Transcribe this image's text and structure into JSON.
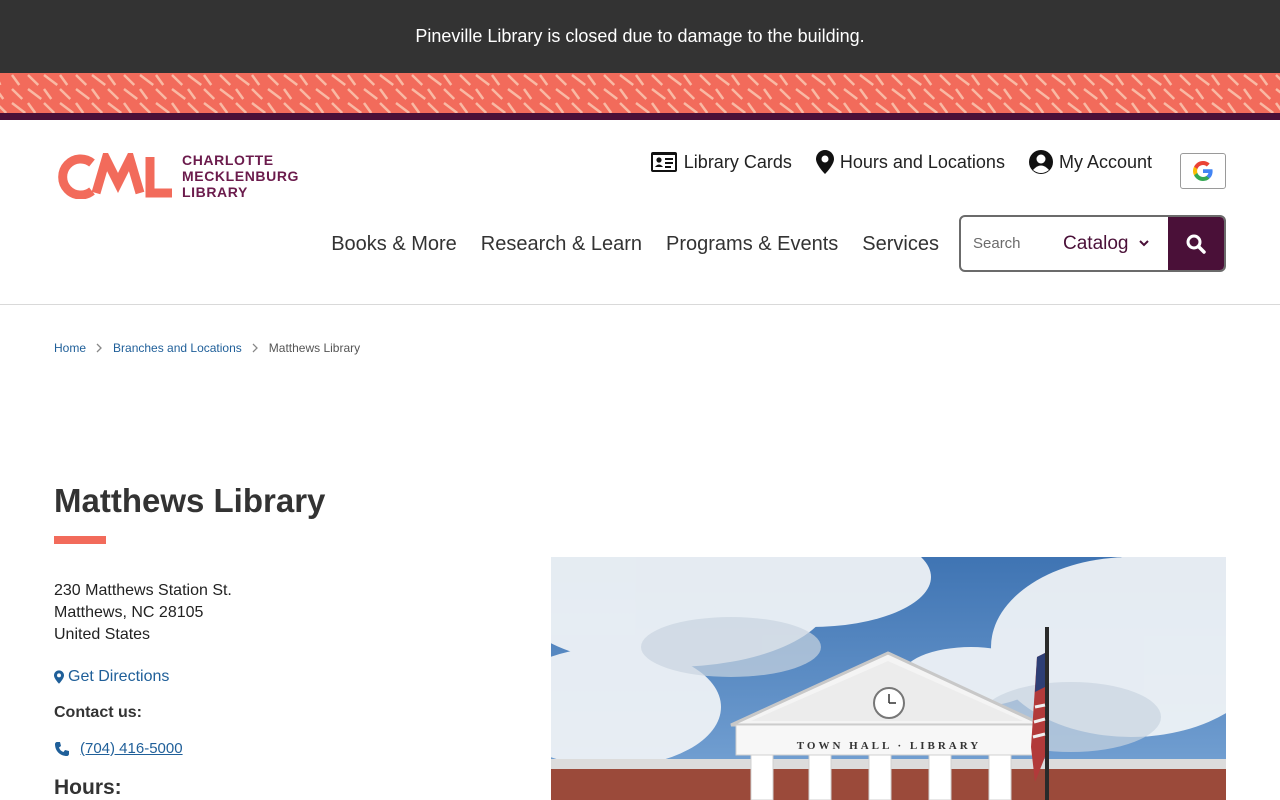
{
  "alert": {
    "message": "Pineville Library is closed due to damage to the building."
  },
  "brand": {
    "logo_mark": "CML",
    "logo_lines": [
      "CHARLOTTE",
      "MECKLENBURG",
      "LIBRARY"
    ],
    "colors": {
      "plum": "#4a1038",
      "coral": "#f26b5b",
      "dark_bar": "#333333",
      "link": "#1f5f99"
    }
  },
  "utility_nav": [
    {
      "label": "Library Cards",
      "icon": "id-card-icon"
    },
    {
      "label": "Hours and Locations",
      "icon": "map-pin-icon"
    },
    {
      "label": "My Account",
      "icon": "user-circle-icon"
    }
  ],
  "google_translate": {
    "icon": "google-g-icon"
  },
  "main_nav": [
    {
      "label": "Books & More"
    },
    {
      "label": "Research & Learn"
    },
    {
      "label": "Programs & Events"
    },
    {
      "label": "Services"
    }
  ],
  "search": {
    "placeholder": "Search",
    "scope": "Catalog",
    "button_icon": "search-icon"
  },
  "breadcrumb": {
    "home": "Home",
    "branches": "Branches and Locations",
    "current": "Matthews Library"
  },
  "page": {
    "title": "Matthews Library",
    "address_line1": "230 Matthews Station St.",
    "address_line2": "Matthews, NC 28105",
    "address_line3": "United States",
    "directions_label": "Get Directions",
    "contact_heading": "Contact us:",
    "phone": "(704) 416-5000",
    "hours_heading": "Hours:"
  },
  "photo": {
    "sign_text": "TOWN HALL · LIBRARY"
  }
}
